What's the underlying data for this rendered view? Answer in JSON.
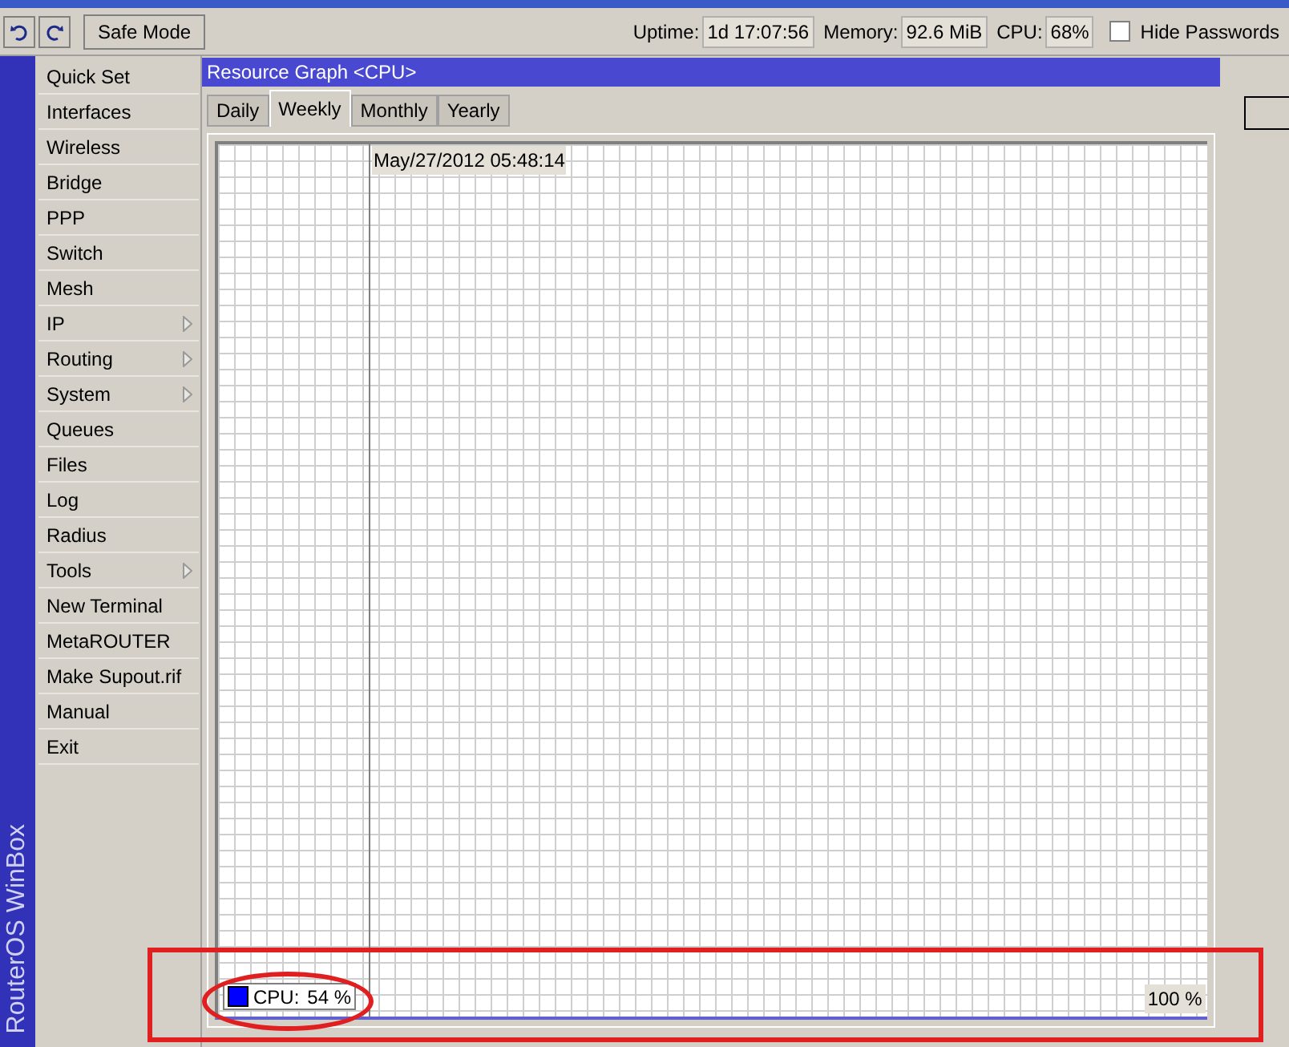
{
  "toolbar": {
    "safe_mode": "Safe Mode",
    "uptime_label": "Uptime:",
    "uptime": "1d 17:07:56",
    "memory_label": "Memory:",
    "memory": "92.6 MiB",
    "cpu_label": "CPU:",
    "cpu": "68%",
    "hide_passwords": {
      "label": "Hide Passwords",
      "checked": false
    }
  },
  "sidebar": {
    "brand": "RouterOS WinBox",
    "items": [
      {
        "label": "Quick Set",
        "submenu": false
      },
      {
        "label": "Interfaces",
        "submenu": false
      },
      {
        "label": "Wireless",
        "submenu": false
      },
      {
        "label": "Bridge",
        "submenu": false
      },
      {
        "label": "PPP",
        "submenu": false
      },
      {
        "label": "Switch",
        "submenu": false
      },
      {
        "label": "Mesh",
        "submenu": false
      },
      {
        "label": "IP",
        "submenu": true
      },
      {
        "label": "Routing",
        "submenu": true
      },
      {
        "label": "System",
        "submenu": true
      },
      {
        "label": "Queues",
        "submenu": false
      },
      {
        "label": "Files",
        "submenu": false
      },
      {
        "label": "Log",
        "submenu": false
      },
      {
        "label": "Radius",
        "submenu": false
      },
      {
        "label": "Tools",
        "submenu": true
      },
      {
        "label": "New Terminal",
        "submenu": false
      },
      {
        "label": "MetaROUTER",
        "submenu": false
      },
      {
        "label": "Make Supout.rif",
        "submenu": false
      },
      {
        "label": "Manual",
        "submenu": false
      },
      {
        "label": "Exit",
        "submenu": false
      }
    ]
  },
  "window": {
    "title": "Resource Graph <CPU>",
    "tabs": [
      {
        "label": "Daily",
        "selected": false
      },
      {
        "label": "Weekly",
        "selected": true
      },
      {
        "label": "Monthly",
        "selected": false
      },
      {
        "label": "Yearly",
        "selected": false
      }
    ],
    "graph": {
      "timestamp": "May/27/2012 05:48:14",
      "legend": {
        "label": "CPU:",
        "value": "54 %",
        "color": "#0000ff"
      },
      "scale": "100 %"
    }
  }
}
